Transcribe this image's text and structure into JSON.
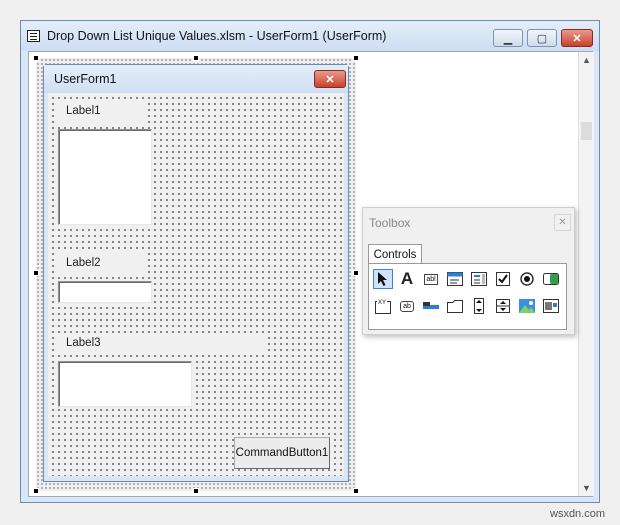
{
  "window": {
    "title": "Drop Down List Unique Values.xlsm - UserForm1 (UserForm)",
    "minimize": "▁",
    "maximize": "▢",
    "close": "✕"
  },
  "form": {
    "title": "UserForm1",
    "close": "✕",
    "label1": "Label1",
    "label2": "Label2",
    "label3": "Label3",
    "button": "CommandButton1"
  },
  "toolbox": {
    "title": "Toolbox",
    "close": "✕",
    "tab": "Controls",
    "tools_row1": [
      "select-objects-icon",
      "label-tool-icon",
      "textbox-tool-icon",
      "combobox-tool-icon",
      "listbox-tool-icon",
      "checkbox-tool-icon",
      "optionbutton-tool-icon",
      "togglebutton-tool-icon"
    ],
    "tools_row2": [
      "frame-tool-icon",
      "commandbutton-tool-icon",
      "tabstrip-tool-icon",
      "multipage-tool-icon",
      "scrollbar-tool-icon",
      "spinbutton-tool-icon",
      "image-tool-icon",
      "refedit-tool-icon"
    ],
    "label_glyph": "A",
    "textbox_glyph": "abl",
    "frame_glyph": "XY",
    "cmd_glyph": "ab"
  },
  "scroll": {
    "up": "▲",
    "down": "▼"
  },
  "watermark": "wsxdn.com"
}
